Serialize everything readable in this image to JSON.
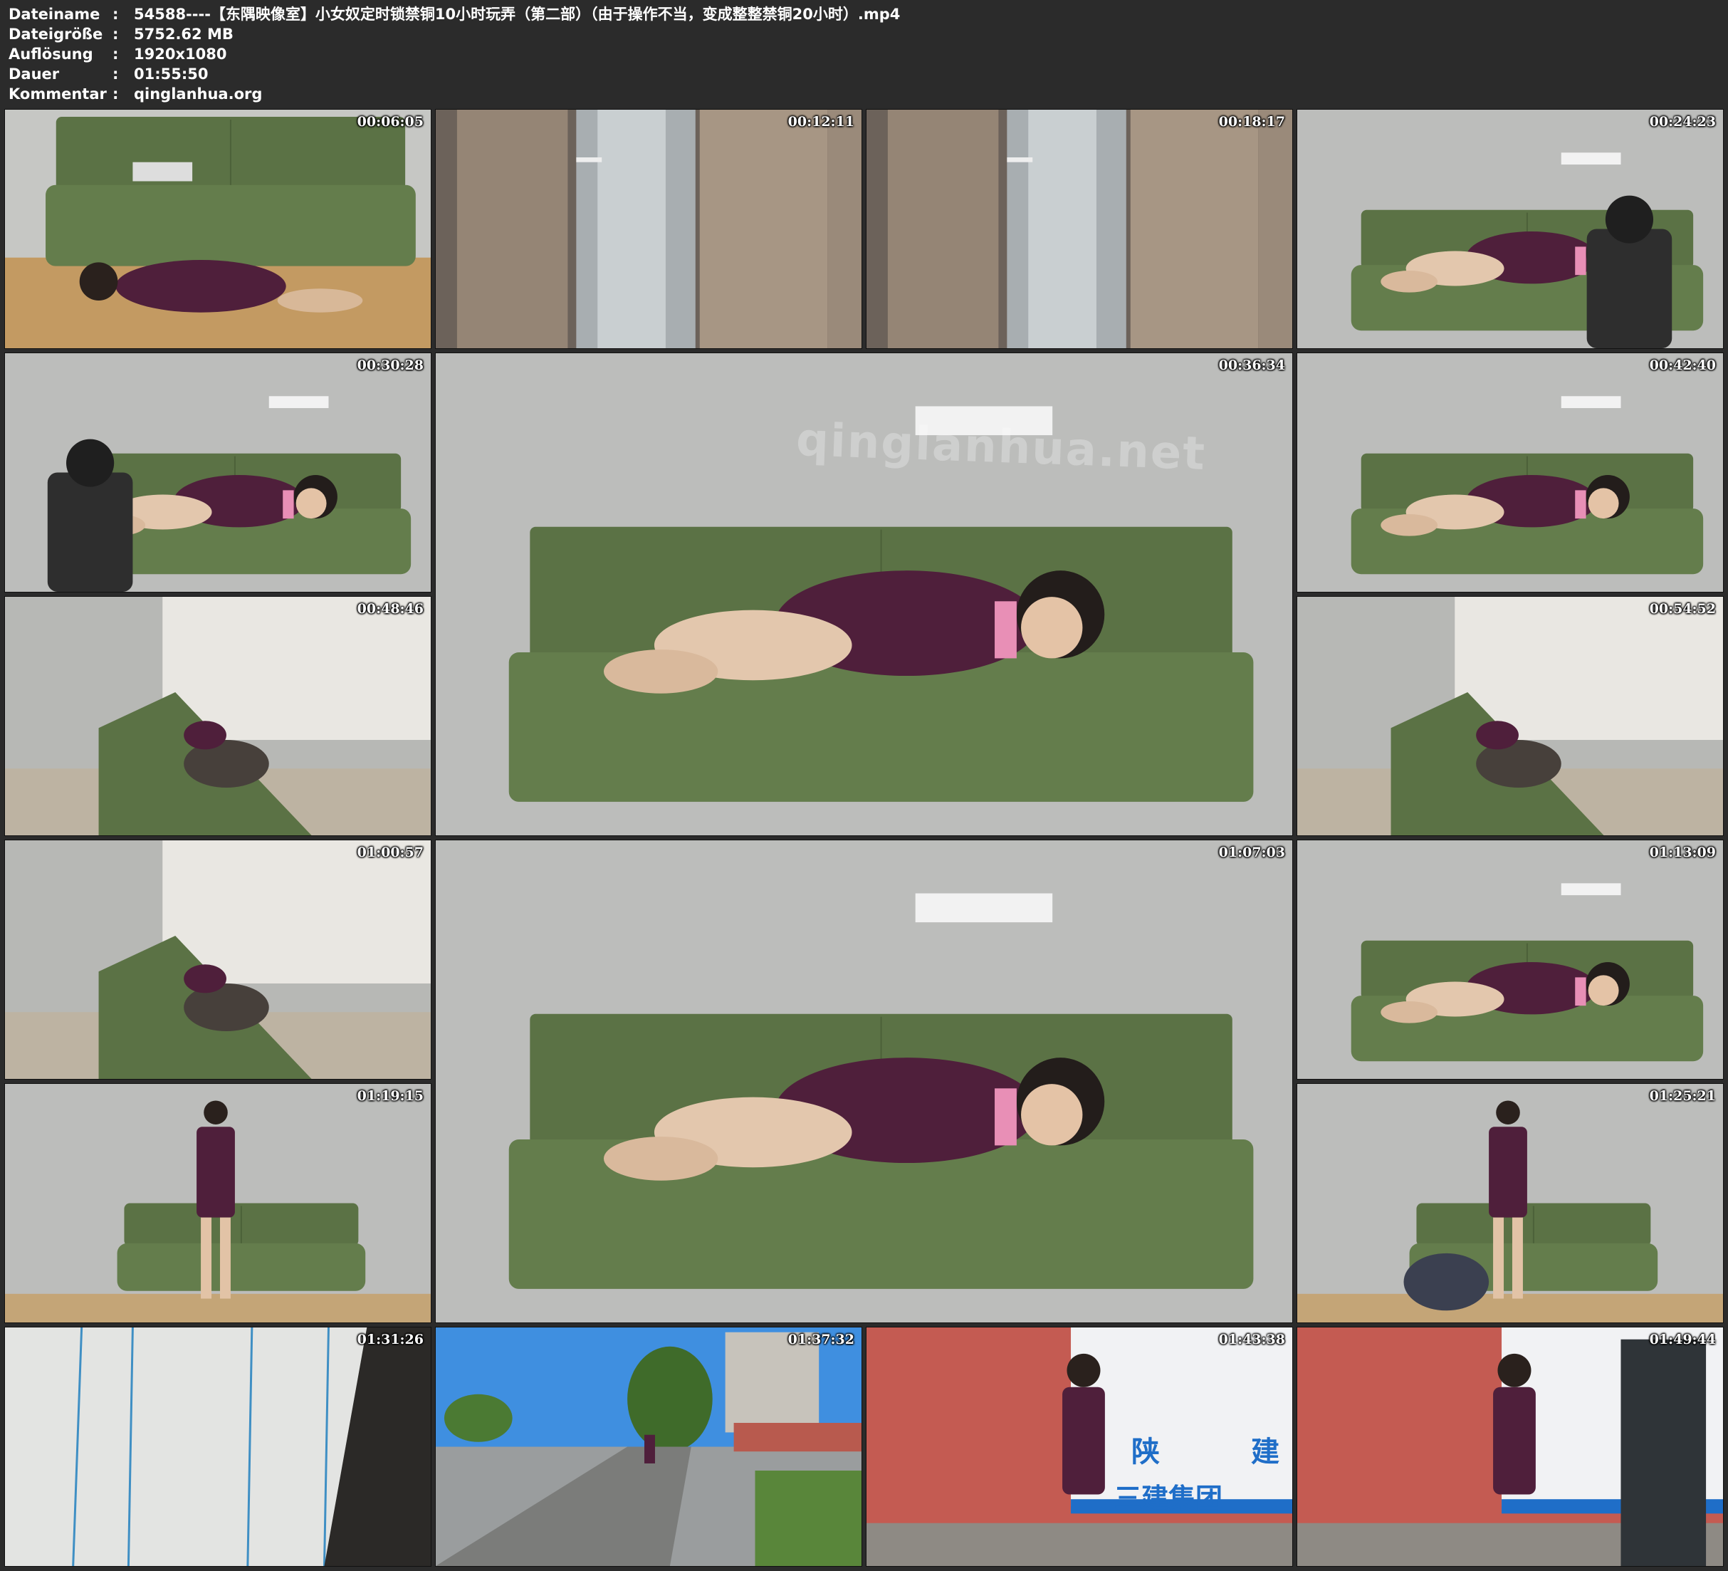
{
  "meta": {
    "rows": [
      {
        "key": "Dateiname",
        "value": "54588----【东隅映像室】小女奴定时锁禁铜10小时玩弄（第二部）（由于操作不当，变成整整禁铜20小时）.mp4"
      },
      {
        "key": "Dateigröße",
        "value": "5752.62 MB"
      },
      {
        "key": "Auflösung",
        "value": "1920x1080"
      },
      {
        "key": "Dauer",
        "value": "01:55:50"
      },
      {
        "key": "Kommentar",
        "value": "qinglanhua.org"
      }
    ],
    "separator": ":"
  },
  "thumbnails": [
    {
      "timestamp": "00:06:05",
      "scene": "sofa-floor"
    },
    {
      "timestamp": "00:12:11",
      "scene": "door"
    },
    {
      "timestamp": "00:18:17",
      "scene": "door"
    },
    {
      "timestamp": "00:24:23",
      "scene": "sofa-masked"
    },
    {
      "timestamp": "00:30:28",
      "scene": "sofa-masked-left"
    },
    {
      "timestamp": "00:36:34",
      "scene": "sofa-sleep-large",
      "watermark": "qinglanhua.net"
    },
    {
      "timestamp": "00:42:40",
      "scene": "sofa-sleep"
    },
    {
      "timestamp": "00:48:46",
      "scene": "sofa-angle"
    },
    {
      "timestamp": "00:54:52",
      "scene": "sofa-angle"
    },
    {
      "timestamp": "01:00:57",
      "scene": "sofa-angle"
    },
    {
      "timestamp": "01:07:03",
      "scene": "sofa-sleep-large"
    },
    {
      "timestamp": "01:13:09",
      "scene": "sofa-sleep"
    },
    {
      "timestamp": "01:19:15",
      "scene": "standing"
    },
    {
      "timestamp": "01:25:21",
      "scene": "standing-kneel"
    },
    {
      "timestamp": "01:31:26",
      "scene": "wall-lines"
    },
    {
      "timestamp": "01:37:32",
      "scene": "street"
    },
    {
      "timestamp": "01:43:38",
      "scene": "red-wall",
      "signs": [
        "陕",
        "建",
        "三建集团"
      ]
    },
    {
      "timestamp": "01:49:44",
      "scene": "red-wall-close"
    }
  ],
  "colors": {
    "background": "#2b2b2b",
    "sofa": "#5b7245",
    "dress": "#4f1f3b",
    "wall": "#bcbdbb"
  }
}
